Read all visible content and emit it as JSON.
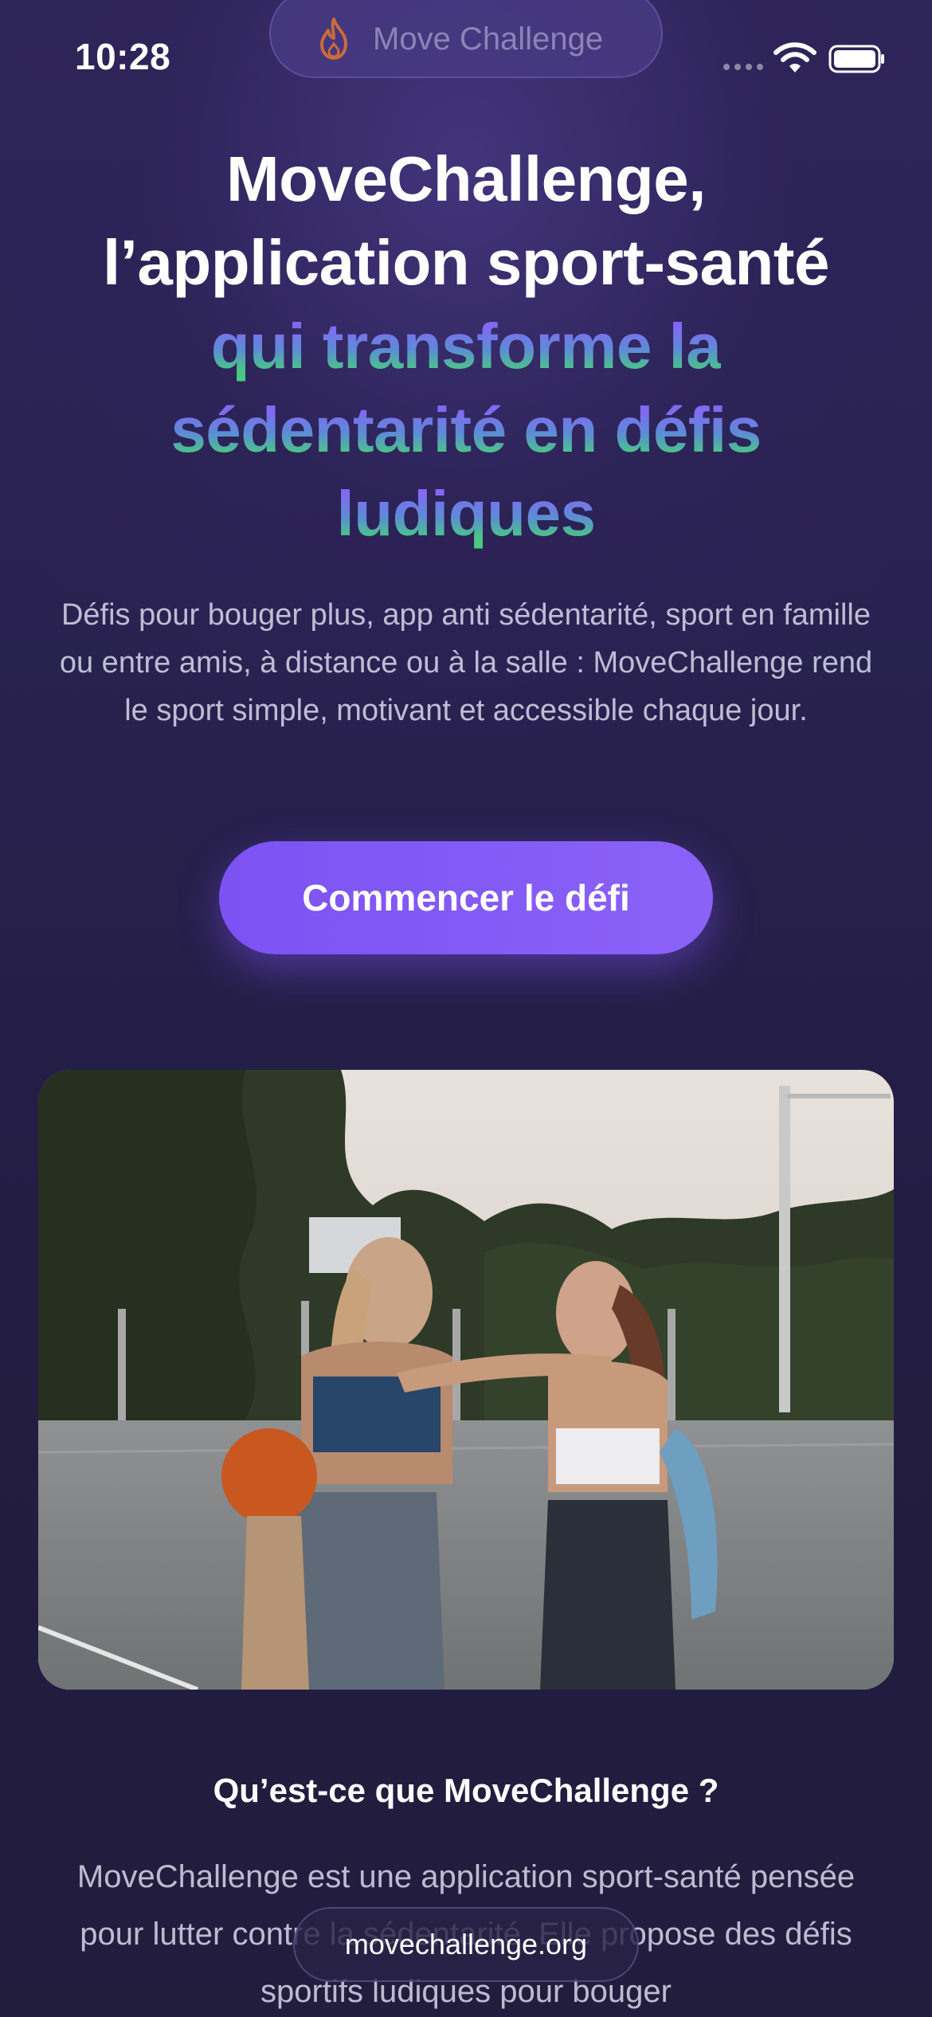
{
  "status_bar": {
    "time": "10:28",
    "app_pill_label": "Move Challenge"
  },
  "hero": {
    "title_line1": "MoveChallenge,",
    "title_line2": "l’application sport-santé",
    "title_accent_line1": "qui transforme la",
    "title_accent_line2": "sédentarité en défis",
    "title_accent_line3": "ludiques",
    "subtitle": "Défis pour bouger plus, app anti sédentarité, sport en famille ou entre amis, à distance ou à la salle : MoveChallenge rend le sport simple, motivant et accessible chaque jour.",
    "cta_label": "Commencer le défi"
  },
  "section": {
    "heading": "Qu’est-ce que MoveChallenge ?",
    "body": "MoveChallenge est une application sport-santé pensée pour lutter contre la sédentarité. Elle propose des défis sportifs ludiques pour bouger"
  },
  "browser": {
    "url": "movechallenge.org"
  },
  "colors": {
    "background": "#221c3d",
    "accent_purple": "#8a5cf6",
    "accent_green": "#44d07a",
    "cta": "#7c52f3"
  },
  "icons": {
    "app_pill": "flame-icon",
    "wifi": "wifi-icon",
    "battery": "battery-icon"
  }
}
